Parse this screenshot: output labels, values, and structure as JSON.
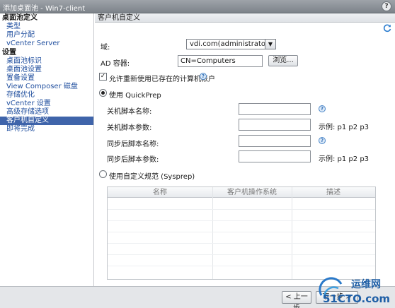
{
  "window": {
    "title": "添加桌面池 - Win7-client",
    "help": "?"
  },
  "sidebar": {
    "sections": [
      {
        "title": "桌面池定义",
        "items": [
          "类型",
          "用户分配",
          "vCenter Server"
        ]
      },
      {
        "title": "设置",
        "items": [
          "桌面池标识",
          "桌面池设置",
          "置备设置",
          "View Composer 磁盘",
          "存储优化",
          "vCenter 设置",
          "高级存储选项",
          "客户机自定义",
          "即将完成"
        ]
      }
    ],
    "selected": "客户机自定义"
  },
  "header": {
    "title": "客户机自定义"
  },
  "form": {
    "domain_label": "域:",
    "domain_value": "vdi.com(administrator)",
    "ad_label": "AD 容器:",
    "ad_value": "CN=Computers",
    "browse_label": "浏览...",
    "reuse_label": "允许重新使用已存在的计算机帐户",
    "reuse_checked": true,
    "quickprep_label": "使用 QuickPrep",
    "shutdown_script_name": "关机脚本名称:",
    "shutdown_script_params": "关机脚本参数:",
    "sync_script_name": "同步后脚本名称:",
    "sync_script_params": "同步后脚本参数:",
    "example_1": "示例: p1 p2 p3",
    "example_2": "示例: p1 p2 p3",
    "sysprep_label": "使用自定义规范 (Sysprep)",
    "table_headers": [
      "名称",
      "客户机操作系统",
      "描述"
    ]
  },
  "footer": {
    "back_label": "< 上一步",
    "next_label": "下一步 >"
  },
  "watermark": {
    "line1": "运维网",
    "line2": "51CTO.com"
  },
  "colors": {
    "selected_bg": "#3f64aa",
    "link": "#1f4e9e",
    "titlebar": "#8a9097"
  }
}
